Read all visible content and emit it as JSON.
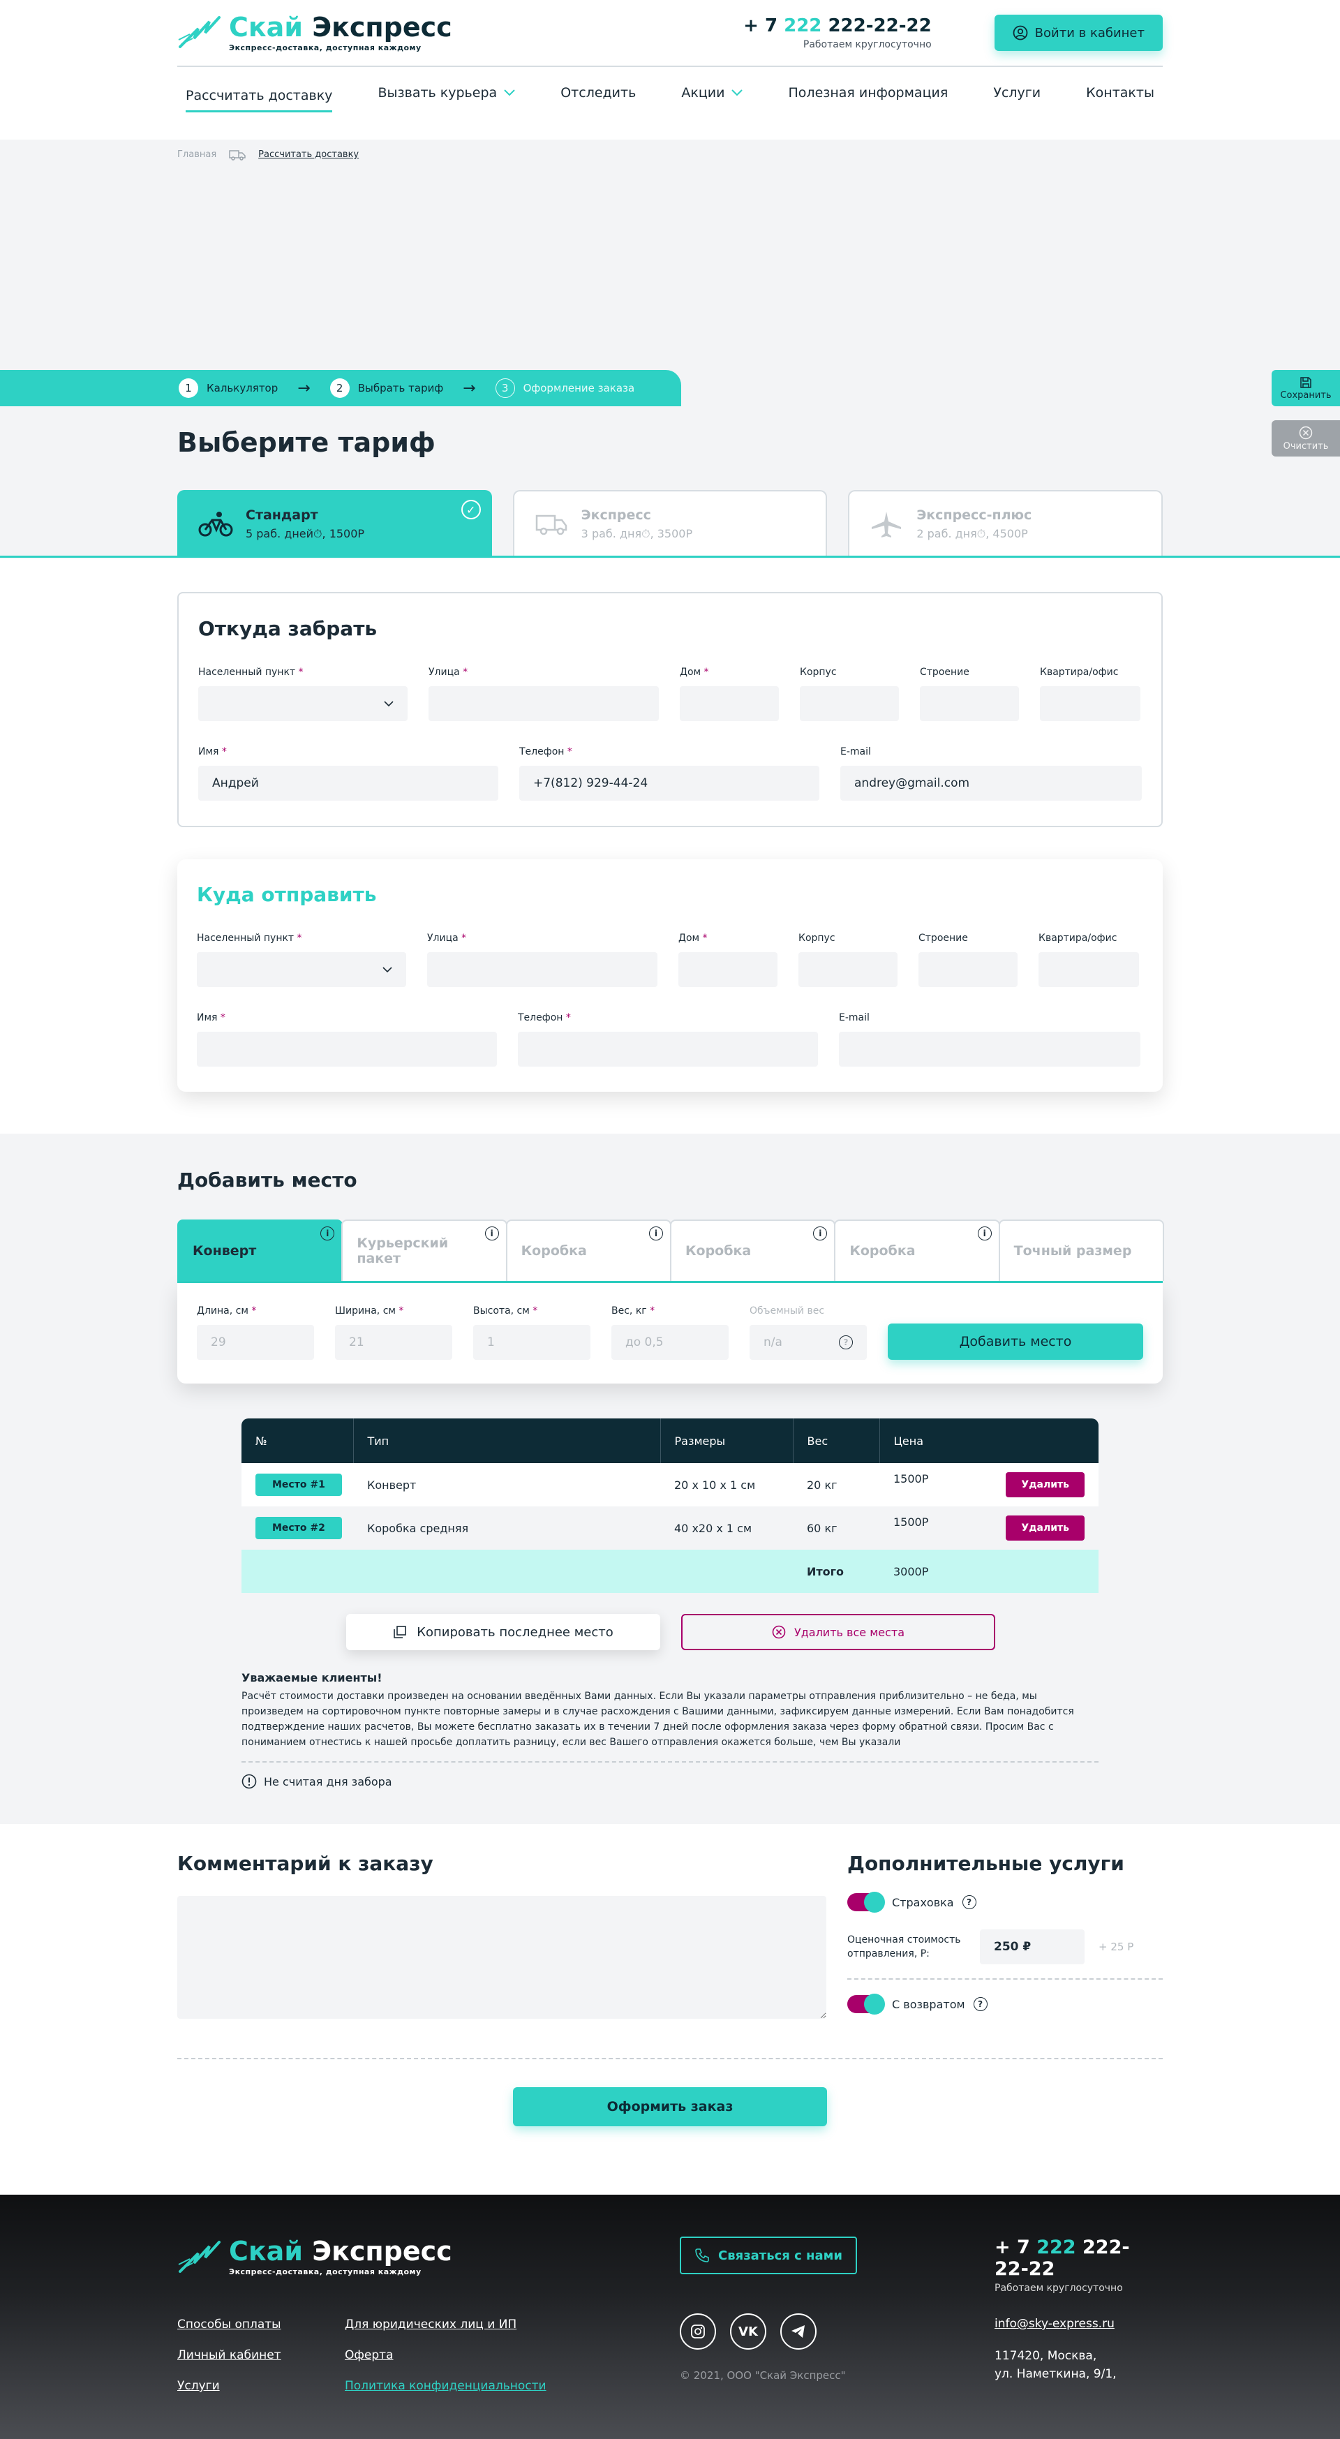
{
  "brand": {
    "name_part1": "Скай",
    "name_part2": "Экспресс",
    "slogan": "Экспресс-доставка, доступная каждому"
  },
  "header": {
    "phone_prefix": "+ 7 ",
    "phone_code": "222",
    "phone_number": " 222-22-22",
    "phone_note": "Работаем круглосуточно",
    "login_label": "Войти в кабинет"
  },
  "nav": [
    "Рассчитать доставку",
    "Вызвать курьера",
    "Отследить",
    "Акции",
    "Полезная информация",
    "Услуги",
    "Контакты"
  ],
  "breadcrumb": {
    "home": "Главная",
    "current": "Рассчитать доставку"
  },
  "steps": [
    {
      "num": "1",
      "label": "Калькулятор"
    },
    {
      "num": "2",
      "label": "Выбрать тариф"
    },
    {
      "num": "3",
      "label": "Оформление заказа"
    }
  ],
  "side": {
    "save": "Сохранить",
    "clear": "Очистить"
  },
  "page_title": "Выберите тариф",
  "tariffs": [
    {
      "title": "Стандарт",
      "days": "5 раб. дней",
      "price": ", 1500Р"
    },
    {
      "title": "Экспресс",
      "days": "3 раб. дня",
      "price": ", 3500Р"
    },
    {
      "title": "Экспресс-плюс",
      "days": "2 раб. дня",
      "price": ", 4500Р"
    }
  ],
  "from_form": {
    "title": "Откуда забрать",
    "labels": {
      "city": "Населенный пункт",
      "street": "Улица",
      "house": "Дом",
      "building": "Корпус",
      "structure": "Строение",
      "flat": "Квартира/офис",
      "name": "Имя",
      "phone": "Телефон",
      "email": "E-mail"
    },
    "values": {
      "name": "Андрей",
      "phone": "+7(812) 929-44-24",
      "email": "andrey@gmail.com"
    }
  },
  "to_form": {
    "title": "Куда отправить"
  },
  "add_place": {
    "title": "Добавить место",
    "tabs": [
      "Конверт",
      "Курьерский пакет",
      "Коробка",
      "Коробка",
      "Коробка",
      "Точный размер"
    ],
    "labels": {
      "length": "Длина, см",
      "width": "Ширина, см",
      "height": "Высота, см",
      "weight": "Вес, кг",
      "volume": "Объемный вес"
    },
    "values": {
      "length": "29",
      "width": "21",
      "height": "1",
      "weight": "до 0,5",
      "volume": "n/a"
    },
    "button": "Добавить место"
  },
  "table": {
    "headers": [
      "№",
      "Тип",
      "Размеры",
      "Вес",
      "Цена"
    ],
    "rows": [
      {
        "tag": "Место #1",
        "type": "Конверт",
        "size": "20 х 10 х 1 см",
        "weight": "20 кг",
        "price": "1500Р",
        "del": "Удалить"
      },
      {
        "tag": "Место #2",
        "type": "Коробка средняя",
        "size": "40 х20 х 1 см",
        "weight": "60 кг",
        "price": "1500Р",
        "del": "Удалить"
      }
    ],
    "total_label": "Итого",
    "total_value": "3000Р"
  },
  "actions": {
    "copy": "Копировать последнее место",
    "delete_all": "Удалить все места"
  },
  "notice": {
    "title": "Уважаемые клиенты!",
    "text": "Расчёт стоимости доставки произведен на основании введённых Вами данных. Если Вы указали параметры отправления приблизительно – не беда, мы произведем на сортировочном пункте повторные замеры и в случае расхождения с Вашими данными, зафиксируем данные измерений. Если Вам понадобится подтверждение наших расчетов, Вы можете бесплатно заказать их в течении 7 дней после оформления заказа через форму обратной связи. Просим Вас с пониманием отнестись к нашей просьбе доплатить разницу, если вес Вашего отправления окажется больше, чем Вы указали",
    "note": "Не считая дня забора"
  },
  "comment": {
    "title": "Комментарий к заказу"
  },
  "extras": {
    "title": "Дополнительные услуги",
    "insurance": "Страховка",
    "cost_label": "Оценочная стоимость отправления, Р:",
    "cost_value": "250 ₽",
    "cost_add": "+ 25 Р",
    "return": "С возвратом"
  },
  "submit": "Оформить заказ",
  "footer": {
    "contact_btn": "Связаться с нами",
    "links": [
      "Способы оплаты",
      "Для юридических лиц и ИП",
      "Личный кабинет",
      "Оферта",
      "Услуги",
      "Политика конфиденциальности"
    ],
    "copyright": "© 2021, ООО \"Скай Экспресс\"",
    "email": "info@sky-express.ru",
    "address1": "117420, Москва,",
    "address2": "ул. Наметкина, 9/1,"
  },
  "colors": {
    "accent": "#2ed1c4",
    "dark": "#0d2b36",
    "danger": "#a8006a"
  }
}
